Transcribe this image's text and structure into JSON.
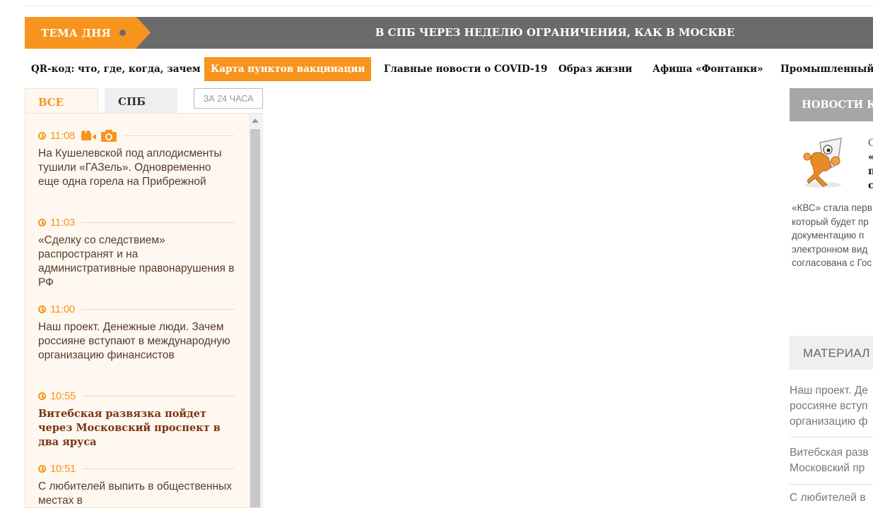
{
  "theme_of_day": {
    "tag": "ТЕМА ДНЯ",
    "headline": "В СПБ ЧЕРЕЗ НЕДЕЛЮ ОГРАНИЧЕНИЯ, КАК В МОСКВЕ"
  },
  "subnav": [
    "QR-код: что, где, когда, зачем",
    "Карта пунктов вакцинации",
    "Главные новости о COVID-19",
    "Образ жизни",
    "Афиша «Фонтанки»",
    "Промышленный"
  ],
  "feed": {
    "tabs": {
      "all": "ВСЕ",
      "spb": "СПБ",
      "last24": "ЗА 24 ЧАСА"
    },
    "items": [
      {
        "time": "11:08",
        "text": "На Кушелевской под аплодисменты тушили «ГАЗель». Одновременно еще одна горела на Прибрежной"
      },
      {
        "time": "11:03",
        "text": "«Сделку со следствием» распространят и на административные правонарушения в РФ"
      },
      {
        "time": "11:00",
        "text": "Наш проект. Денежные люди. Зачем россияне вступают в международную организацию финансистов"
      },
      {
        "time": "10:55",
        "text": "Витебская развязка пойдет через Московский проспект в два яруса"
      },
      {
        "time": "10:51",
        "text": "С любителей выпить в общественных местах в"
      }
    ]
  },
  "right": {
    "company_news_header": "НОВОСТИ КО",
    "company_title_lines": [
      "О",
      "«",
      "п",
      "с"
    ],
    "company_lead": [
      "«КВС» стала перв",
      "который будет пр",
      "документацию п",
      "электронном вид",
      "согласована с Гос"
    ],
    "materials_header": "МАТЕРИАЛ",
    "materials": [
      [
        "Наш проект. Де",
        "россияне вступ",
        "организацию ф"
      ],
      [
        "Витебская разв",
        "Московский пр"
      ],
      [
        "С любителей в"
      ]
    ]
  },
  "colors": {
    "accent": "#f7941d",
    "banner": "#6b6b6b",
    "feed_bg": "#fef8f0"
  }
}
